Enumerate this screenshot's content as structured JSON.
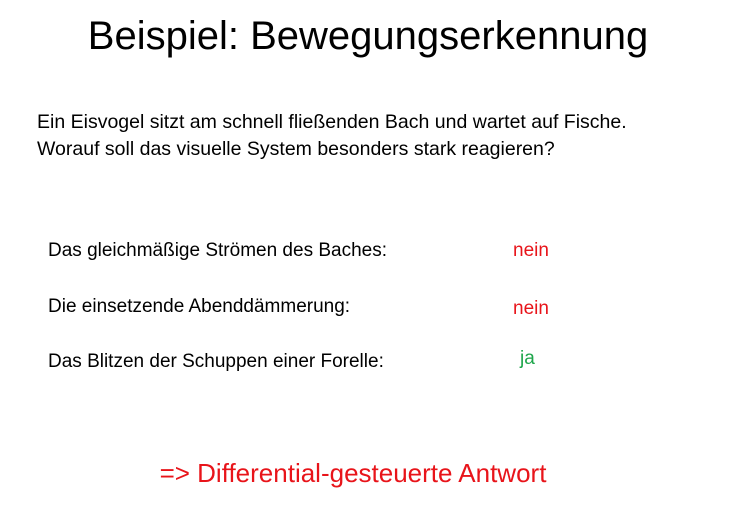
{
  "title": "Beispiel: Bewegungserkennung",
  "question": {
    "line1": "Ein Eisvogel sitzt am schnell fließenden Bach und wartet auf Fische.",
    "line2": "Worauf soll das visuelle System besonders stark reagieren?"
  },
  "items": [
    {
      "label": "Das gleichmäßige Strömen des Baches:",
      "answer": "nein"
    },
    {
      "label": "Die einsetzende Abenddämmerung:",
      "answer": "nein"
    },
    {
      "label": "Das Blitzen der Schuppen einer Forelle:",
      "answer": "ja"
    }
  ],
  "conclusion": "=> Differential-gesteuerte Antwort",
  "colors": {
    "no": "#e8141a",
    "yes": "#1ea64b",
    "conclusion": "#e8141a",
    "text": "#000000",
    "background": "#ffffff"
  }
}
